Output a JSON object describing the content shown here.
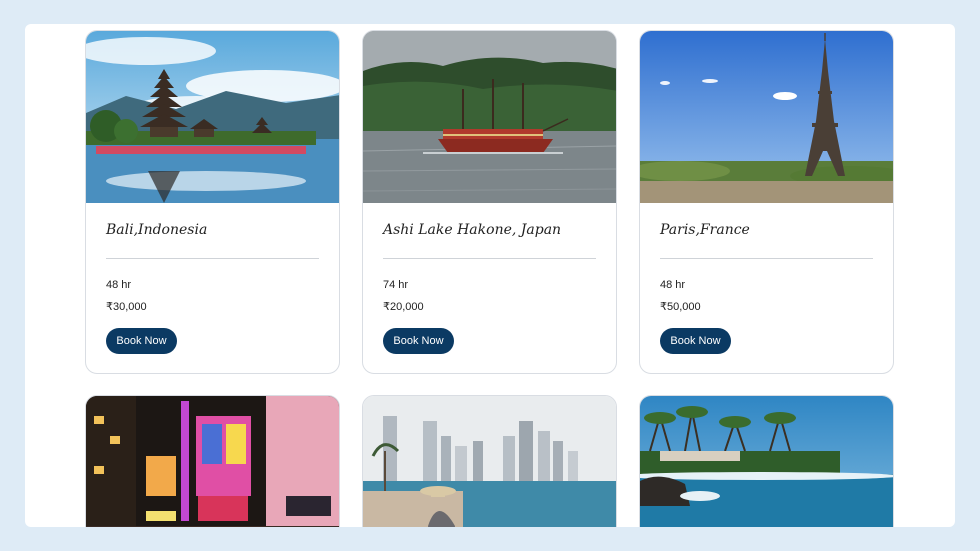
{
  "cards": [
    {
      "title": "Bali,Indonesia",
      "duration": "48 hr",
      "price": "₹30,000",
      "button": "Book Now"
    },
    {
      "title": "Ashi Lake Hakone, Japan",
      "duration": "74 hr",
      "price": "₹20,000",
      "button": "Book Now"
    },
    {
      "title": "Paris,France",
      "duration": "48 hr",
      "price": "₹50,000",
      "button": "Book Now"
    }
  ],
  "colors": {
    "page_bg": "#deebf6",
    "button_bg": "#0b3a63"
  }
}
